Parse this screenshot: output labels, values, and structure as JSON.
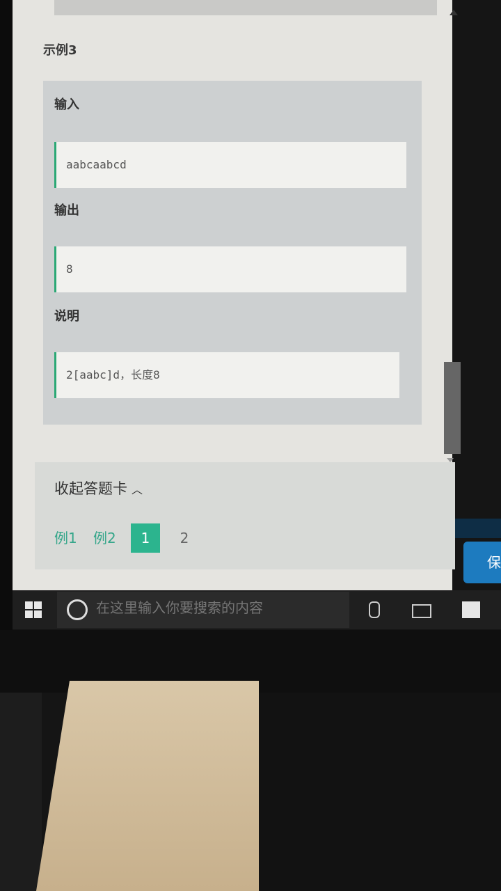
{
  "example": {
    "title": "示例3",
    "input_label": "输入",
    "input_value": "aabcaabcd",
    "output_label": "输出",
    "output_value": "8",
    "explain_label": "说明",
    "explain_value": "2[aabc]d，长度8"
  },
  "answer_card": {
    "toggle_label": "收起答题卡",
    "items": [
      "例1",
      "例2",
      "1",
      "2"
    ],
    "active_index": 2
  },
  "save_button_label": "保",
  "taskbar": {
    "search_placeholder": "在这里输入你要搜索的内容"
  },
  "colors": {
    "accent": "#2cb48e",
    "code_border": "#2aa875",
    "save_button": "#1d7bbf"
  },
  "icons": [
    "windows-start-icon",
    "cortana-icon",
    "microphone-icon",
    "task-view-icon",
    "store-icon",
    "chevron-up-icon"
  ]
}
